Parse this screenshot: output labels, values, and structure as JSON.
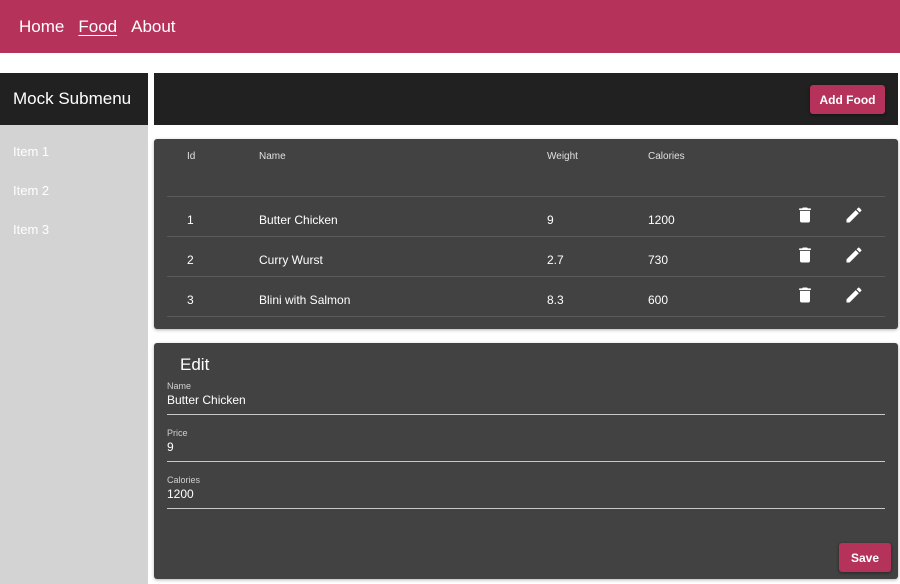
{
  "nav": {
    "items": [
      {
        "label": "Home",
        "active": false
      },
      {
        "label": "Food",
        "active": true
      },
      {
        "label": "About",
        "active": false
      }
    ]
  },
  "sidebar": {
    "title": "Mock Submenu",
    "items": [
      {
        "label": "Item 1"
      },
      {
        "label": "Item 2"
      },
      {
        "label": "Item 3"
      }
    ]
  },
  "toolbar": {
    "add_label": "Add Food"
  },
  "table": {
    "headers": {
      "id": "Id",
      "name": "Name",
      "weight": "Weight",
      "calories": "Calories"
    },
    "rows": [
      {
        "id": "1",
        "name": "Butter Chicken",
        "weight": "9",
        "calories": "1200"
      },
      {
        "id": "2",
        "name": "Curry Wurst",
        "weight": "2.7",
        "calories": "730"
      },
      {
        "id": "3",
        "name": "Blini with Salmon",
        "weight": "8.3",
        "calories": "600"
      }
    ],
    "row_icons": [
      "trash-icon",
      "pencil-icon"
    ]
  },
  "edit": {
    "title": "Edit",
    "fields": [
      {
        "label": "Name",
        "value": "Butter Chicken"
      },
      {
        "label": "Price",
        "value": "9"
      },
      {
        "label": "Calories",
        "value": "1200"
      }
    ],
    "save_label": "Save"
  },
  "colors": {
    "accent": "#b5325b",
    "toolbar": "#212121",
    "card": "#424242",
    "sidebar": "#d3d3d3"
  }
}
